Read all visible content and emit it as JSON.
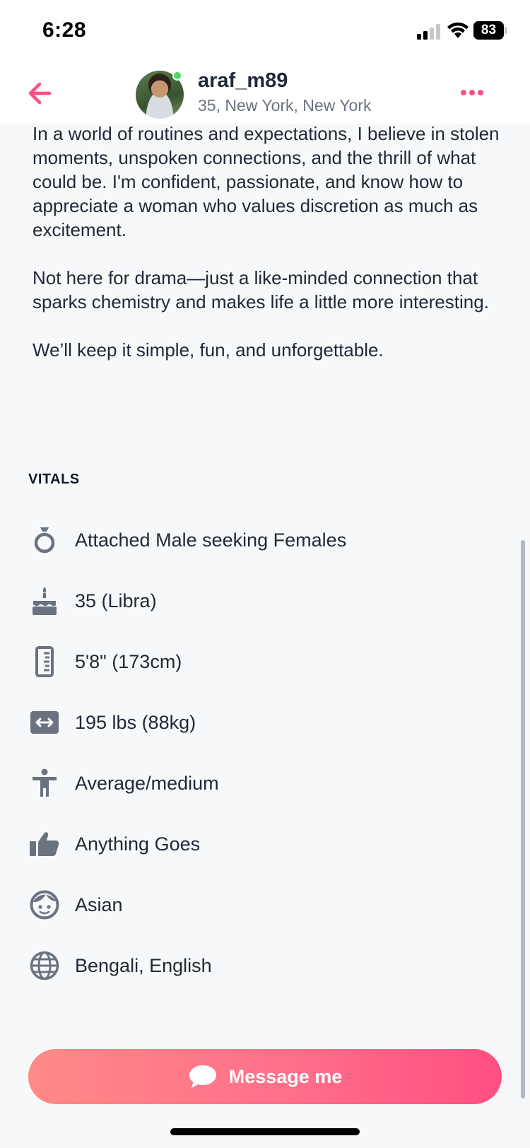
{
  "status_bar": {
    "time": "6:28",
    "battery": "83"
  },
  "header": {
    "username": "araf_m89",
    "location": "35, New York, New York",
    "online": true,
    "back_icon": "arrow-left-icon",
    "more_icon": "more-horizontal-icon"
  },
  "bio": {
    "paragraphs": [
      "In a world of routines and expectations, I believe in stolen moments, unspoken connections, and the thrill of what could be. I'm confident, passionate, and know how to appreciate a woman who values discretion as much as excitement.",
      "Not here for drama—just a like-minded connection that sparks chemistry and makes life a little more interesting.",
      "We’ll keep it simple, fun, and unforgettable."
    ]
  },
  "vitals": {
    "title": "VITALS",
    "items": [
      {
        "icon": "ring-icon",
        "label": "Attached Male seeking Females"
      },
      {
        "icon": "birthday-cake-icon",
        "label": "35 (Libra)"
      },
      {
        "icon": "ruler-icon",
        "label": "5'8\" (173cm)"
      },
      {
        "icon": "weight-arrows-icon",
        "label": "195 lbs (88kg)"
      },
      {
        "icon": "body-type-icon",
        "label": "Average/medium"
      },
      {
        "icon": "thumbs-up-icon",
        "label": "Anything Goes"
      },
      {
        "icon": "face-icon",
        "label": "Asian"
      },
      {
        "icon": "globe-icon",
        "label": "Bengali, English"
      }
    ]
  },
  "message_button": {
    "label": "Message me",
    "icon": "chat-bubble-icon"
  },
  "colors": {
    "accent": "#ff4f82",
    "icon_gray": "#6b7280",
    "online": "#4cd964"
  }
}
